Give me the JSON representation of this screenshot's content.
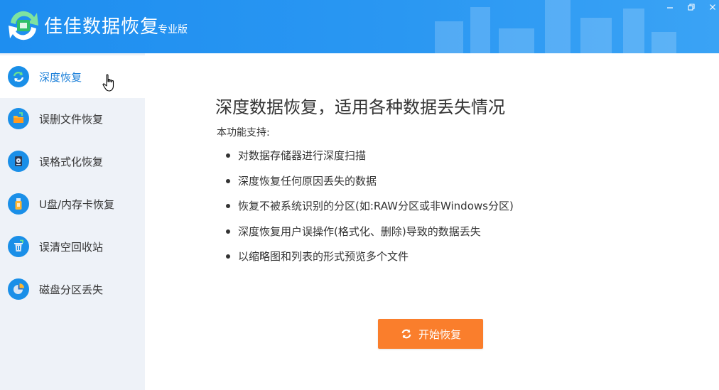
{
  "app": {
    "title": "佳佳数据恢复",
    "edition": "专业版"
  },
  "colors": {
    "header": "#1e8ef0",
    "sidebar_bg": "#eef2f8",
    "accent": "#1a7fd9",
    "start_button": "#fa7e2c"
  },
  "sidebar": {
    "items": [
      {
        "label": "深度恢复",
        "icon": "refresh-icon",
        "active": true
      },
      {
        "label": "误删文件恢复",
        "icon": "folder-icon",
        "active": false
      },
      {
        "label": "误格式化恢复",
        "icon": "disk-icon",
        "active": false
      },
      {
        "label": "U盘/内存卡恢复",
        "icon": "usb-drive-icon",
        "active": false
      },
      {
        "label": "误清空回收站",
        "icon": "recycle-bin-icon",
        "active": false
      },
      {
        "label": "磁盘分区丢失",
        "icon": "pie-chart-icon",
        "active": false
      }
    ]
  },
  "main": {
    "title": "深度数据恢复，适用各种数据丢失情况",
    "subtitle": "本功能支持:",
    "features": [
      "对数据存储器进行深度扫描",
      "深度恢复任何原因丢失的数据",
      "恢复不被系统识别的分区(如:RAW分区或非Windows分区)",
      "深度恢复用户误操作(格式化、删除)导致的数据丢失",
      "以缩略图和列表的形式预览多个文件"
    ],
    "start_button": "开始恢复"
  }
}
